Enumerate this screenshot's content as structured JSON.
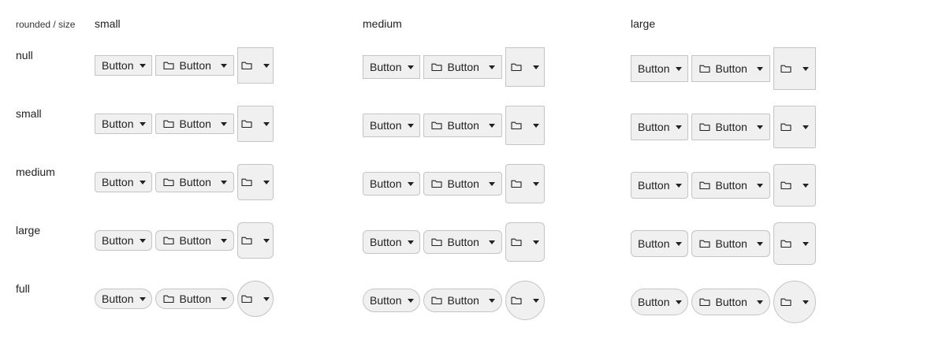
{
  "header": {
    "corner": "rounded / size",
    "columns": [
      "small",
      "medium",
      "large"
    ]
  },
  "rows": [
    "null",
    "small",
    "medium",
    "large",
    "full"
  ],
  "button": {
    "label": "Button",
    "icon": "folder-icon",
    "caret": "caret-down-icon"
  }
}
